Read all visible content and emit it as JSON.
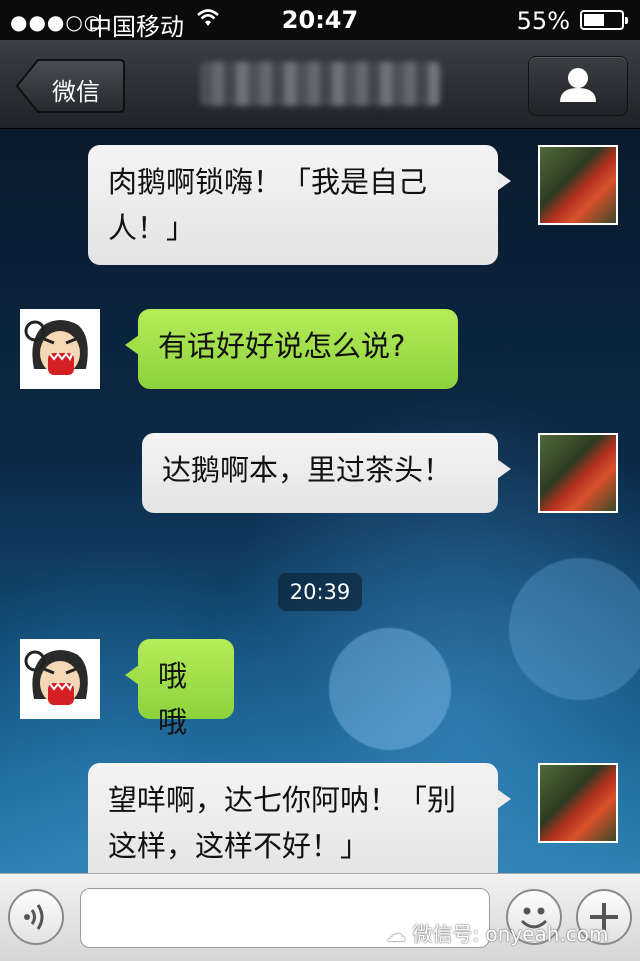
{
  "status_bar": {
    "signal": "●●●○○",
    "carrier": "中国移动",
    "time": "20:47",
    "battery_percent": "55%",
    "battery_level": 0.55
  },
  "nav": {
    "back_label": "微信"
  },
  "messages": [
    {
      "sender": "me",
      "text": "肉鹅啊锁嗨！「我是自己人！」"
    },
    {
      "sender": "them",
      "text": "有话好好说怎么说?"
    },
    {
      "sender": "me",
      "text": "达鹅啊本，里过茶头！"
    },
    {
      "sender": "them",
      "text": "哦哦"
    },
    {
      "sender": "me",
      "text": "望咩啊，达七你阿呐！「别这样，这样不好！」"
    }
  ],
  "timestamp": "20:39",
  "watermark": "微信号: onyeah.com",
  "colors": {
    "incoming_bubble": "#9fdd4a",
    "outgoing_bubble": "#ececec",
    "nav_bar": "#2a2d31"
  }
}
